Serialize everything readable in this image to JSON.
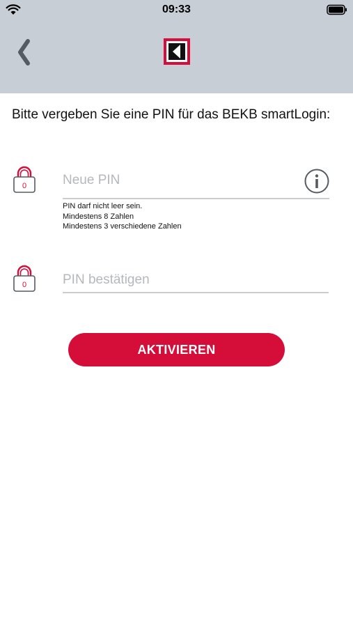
{
  "status_bar": {
    "time": "09:33"
  },
  "header": {
    "back_icon": "chevron-left-icon",
    "logo_icon": "bekb-logo-icon"
  },
  "instruction": "Bitte vergeben Sie eine PIN für das BEKB smartLogin:",
  "new_pin": {
    "lock_digit": "0",
    "placeholder": "Neue PIN",
    "value": "",
    "info_icon": "info-icon",
    "hints": [
      "PIN darf nicht leer sein.",
      "Mindestens 8 Zahlen",
      "Mindestens 3 verschiedene Zahlen"
    ]
  },
  "confirm_pin": {
    "lock_digit": "0",
    "placeholder": "PIN bestätigen",
    "value": ""
  },
  "activate_button": {
    "label": "AKTIVIEREN"
  },
  "colors": {
    "header_bg": "#c8ced6",
    "accent": "#d40d39",
    "divider": "#c9cdd2",
    "placeholder": "#b4b8bd"
  }
}
